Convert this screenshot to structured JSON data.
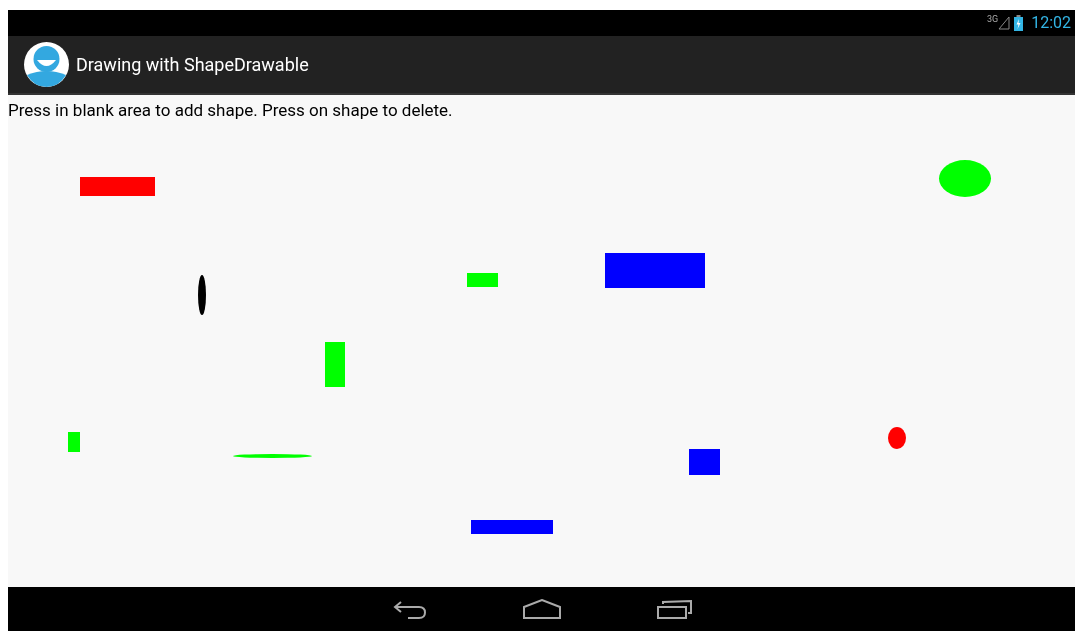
{
  "status_bar": {
    "network": "3G",
    "time": "12:02"
  },
  "action_bar": {
    "title": "Drawing with ShapeDrawable"
  },
  "instructions": "Press in blank area to add shape. Press on shape to delete.",
  "shapes": [
    {
      "kind": "rect",
      "color": "#ff0000"
    },
    {
      "kind": "oval",
      "color": "#00ff00"
    },
    {
      "kind": "oval",
      "color": "#000000"
    },
    {
      "kind": "rect",
      "color": "#00ff00"
    },
    {
      "kind": "rect",
      "color": "#0000ff"
    },
    {
      "kind": "rect",
      "color": "#00ff00"
    },
    {
      "kind": "rect",
      "color": "#00ff00"
    },
    {
      "kind": "oval",
      "color": "#00ff00"
    },
    {
      "kind": "rect",
      "color": "#0000ff"
    },
    {
      "kind": "oval",
      "color": "#ff0000"
    },
    {
      "kind": "rect",
      "color": "#0000ff"
    }
  ]
}
